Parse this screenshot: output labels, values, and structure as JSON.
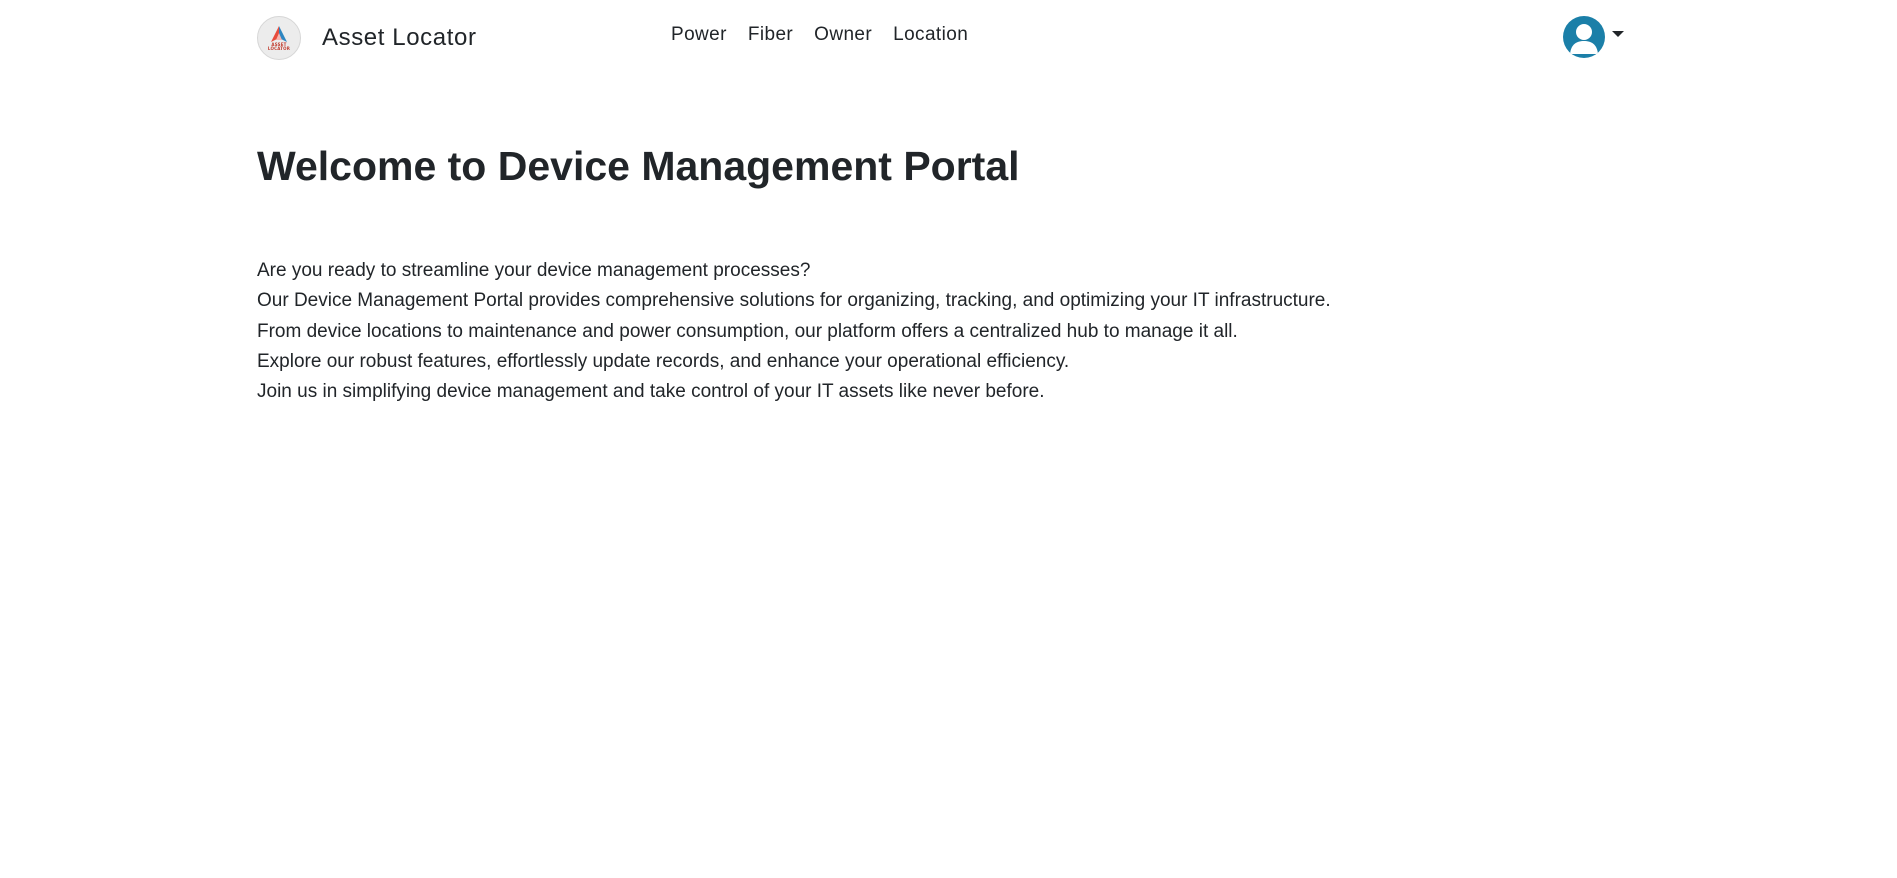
{
  "app": {
    "brand_name": "Asset Locator",
    "logo_text_line1": "ASSET",
    "logo_text_line2": "LOCATOR"
  },
  "nav": {
    "items": [
      {
        "label": "Power"
      },
      {
        "label": "Fiber"
      },
      {
        "label": "Owner"
      },
      {
        "label": "Location"
      }
    ]
  },
  "user_menu": {
    "avatar_icon": "user-avatar-icon",
    "dropdown_icon": "caret-down-icon"
  },
  "main": {
    "title": "Welcome to Device Management Portal",
    "paragraph_lines": [
      "Are you ready to streamline your device management processes?",
      "Our Device Management Portal provides comprehensive solutions for organizing, tracking, and optimizing your IT infrastructure.",
      "From device locations to maintenance and power consumption, our platform offers a centralized hub to manage it all.",
      "Explore our robust features, effortlessly update records, and enhance your operational efficiency.",
      "Join us in simplifying device management and take control of your IT assets like never before."
    ]
  },
  "colors": {
    "avatar_bg": "#1b7fa8",
    "text": "#212529",
    "logo_red": "#e74c3c",
    "logo_blue": "#2e86c1"
  }
}
